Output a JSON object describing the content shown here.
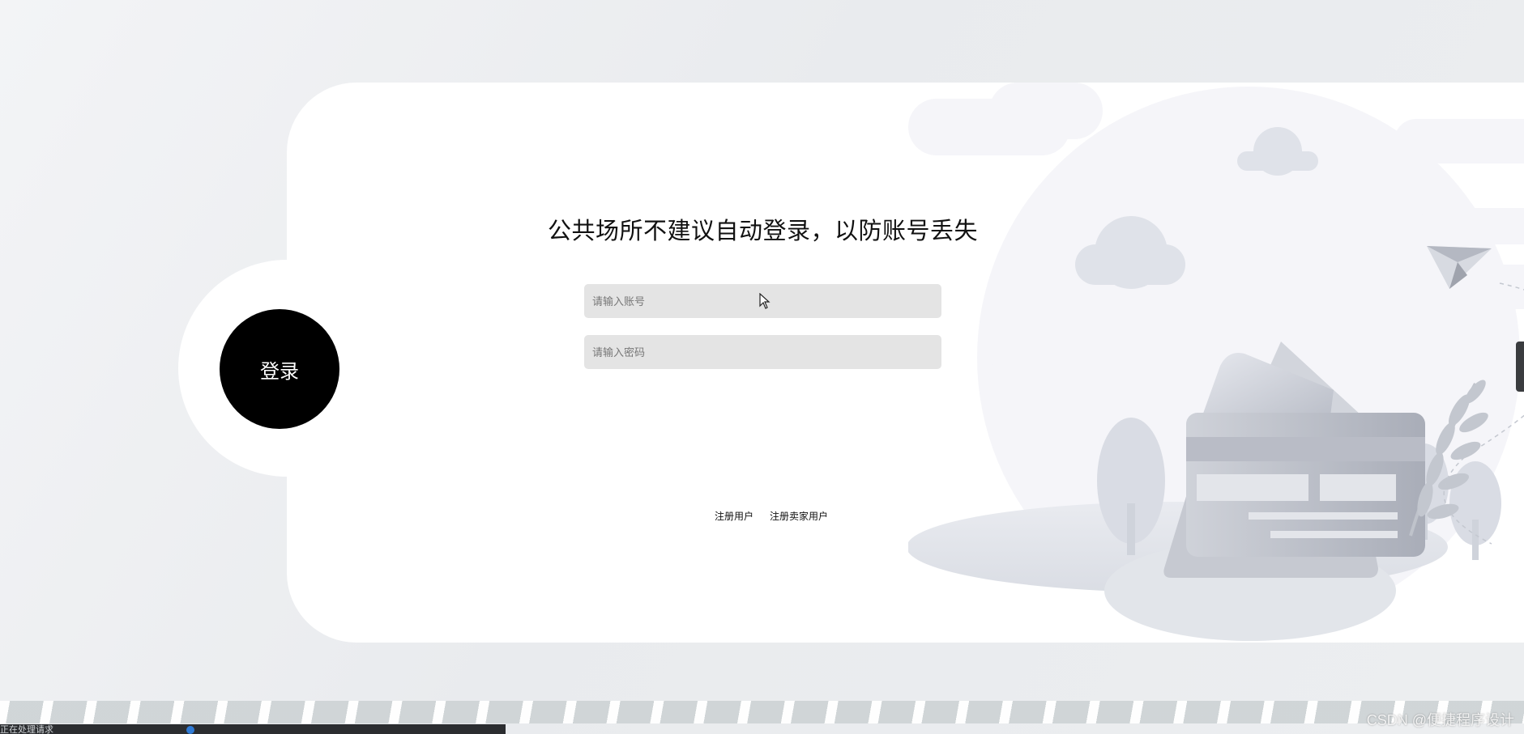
{
  "login_panel": {
    "title": "公共场所不建议自动登录，以防账号丢失",
    "login_button_label": "登录",
    "account_input": {
      "value": "",
      "placeholder": "请输入账号"
    },
    "password_input": {
      "value": "",
      "placeholder": "请输入密码"
    },
    "links": {
      "register_user": "注册用户",
      "register_seller": "注册卖家用户"
    }
  },
  "status_bar": {
    "text": "正在处理请求"
  },
  "watermark": {
    "text": "CSDN @便捷程序设计"
  },
  "colors": {
    "page_background": "#eceef0",
    "card_background": "#ffffff",
    "login_circle": "#000000",
    "input_background": "#e4e4e4",
    "illustration_tone": "#d4d8e0"
  },
  "icons": [
    "paper-plane-icon",
    "cloud-icon",
    "tree-icon",
    "plant-icon",
    "card-envelope-illustration",
    "mouse-cursor-icon"
  ]
}
